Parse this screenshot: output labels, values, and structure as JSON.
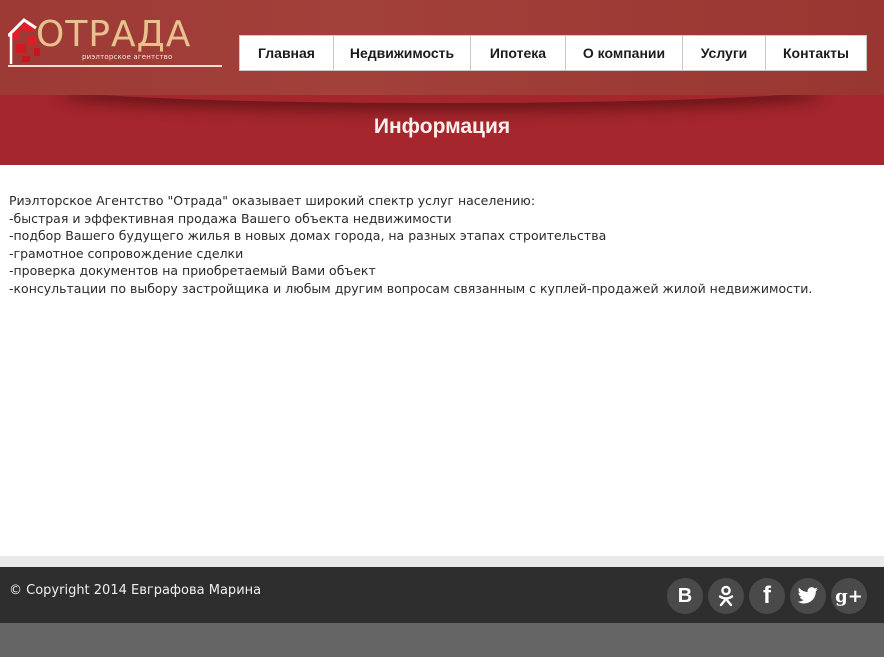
{
  "header": {
    "logo": {
      "word": "ОТРАДА",
      "subtitle": "риэлторское агентство"
    },
    "nav": [
      {
        "label": "Главная"
      },
      {
        "label": "Недвижимость"
      },
      {
        "label": "Ипотека"
      },
      {
        "label": "О компании"
      },
      {
        "label": "Услуги"
      },
      {
        "label": "Контакты"
      }
    ]
  },
  "banner": {
    "title": "Информация"
  },
  "content": {
    "lines": [
      "Риэлторское Агентство \"Отрада\" оказывает широкий спектр услуг населению:",
      "-быстрая и эффективная продажа Вашего объекта недвижимости",
      "-подбор Вашего будущего жилья в новых домах города, на разных этапах строительства",
      "-грамотное сопровождение сделки",
      "-проверка документов на приобретаемый Вами объект",
      "-консультации по выбору застройщика и любым другим вопросам связанным с куплей-продажей жилой недвижимости."
    ]
  },
  "footer": {
    "copyright": "© Copyright 2014 Евграфова Марина",
    "social": [
      {
        "name": "vk-icon",
        "glyph": "В"
      },
      {
        "name": "odnoklassniki-icon",
        "glyph": "ok"
      },
      {
        "name": "facebook-icon",
        "glyph": "f"
      },
      {
        "name": "twitter-icon",
        "glyph": "twitter"
      },
      {
        "name": "google-plus-icon",
        "glyph": "g+"
      }
    ]
  },
  "colors": {
    "header_bg": "#9e3a35",
    "banner_bg": "#a5262d",
    "logo_text": "#e8c18f",
    "logo_mark": "#e01c24",
    "footer_bg": "#2e2e2e",
    "bottom_bar": "#646464"
  }
}
